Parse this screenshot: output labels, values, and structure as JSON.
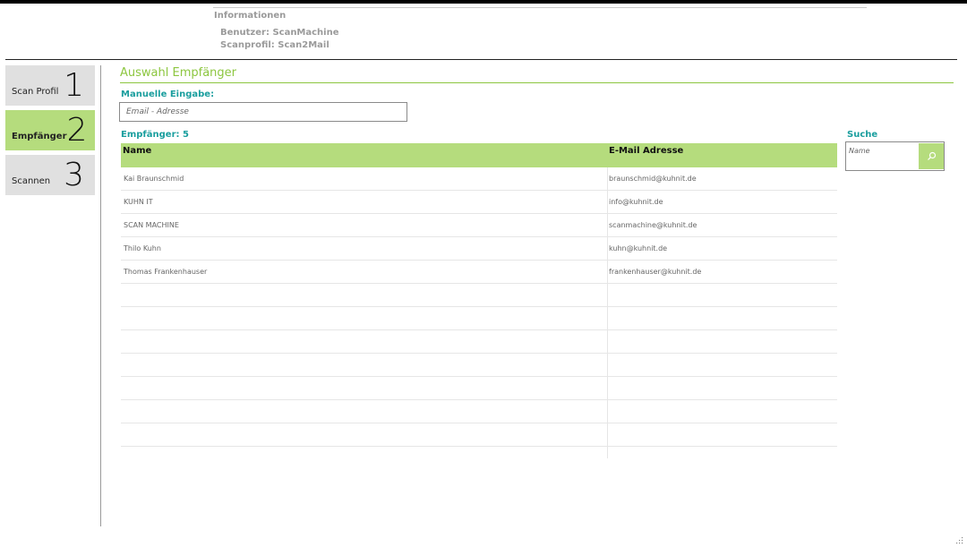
{
  "info": {
    "title": "Informationen",
    "user_line": "Benutzer: ScanMachine",
    "profile_line": "Scanprofil: Scan2Mail"
  },
  "steps": [
    {
      "label": "Scan Profil",
      "number": "1",
      "active": false
    },
    {
      "label": "Empfänger",
      "number": "2",
      "active": true
    },
    {
      "label": "Scannen",
      "number": "3",
      "active": false
    }
  ],
  "section": {
    "title": "Auswahl Empfänger",
    "manual_label": "Manuelle Eingabe:",
    "email_placeholder": "Email - Adresse",
    "count_label": "Empfänger: 5"
  },
  "search": {
    "label": "Suche",
    "placeholder": "Name",
    "icon": "search-icon"
  },
  "table": {
    "headers": {
      "name": "Name",
      "email": "E-Mail Adresse"
    },
    "rows": [
      {
        "name": "Kai Braunschmid",
        "email": "braunschmid@kuhnit.de"
      },
      {
        "name": "KUHN IT",
        "email": "info@kuhnit.de"
      },
      {
        "name": "SCAN MACHINE",
        "email": "scanmachine@kuhnit.de"
      },
      {
        "name": "Thilo Kuhn",
        "email": "kuhn@kuhnit.de"
      },
      {
        "name": "Thomas Frankenhauser",
        "email": "frankenhauser@kuhnit.de"
      },
      {
        "name": "",
        "email": ""
      },
      {
        "name": "",
        "email": ""
      },
      {
        "name": "",
        "email": ""
      },
      {
        "name": "",
        "email": ""
      },
      {
        "name": "",
        "email": ""
      },
      {
        "name": "",
        "email": ""
      },
      {
        "name": "",
        "email": ""
      }
    ]
  },
  "colors": {
    "accent_green": "#b5dc7d",
    "title_green": "#8cc63f",
    "label_teal": "#1a9e9e"
  }
}
